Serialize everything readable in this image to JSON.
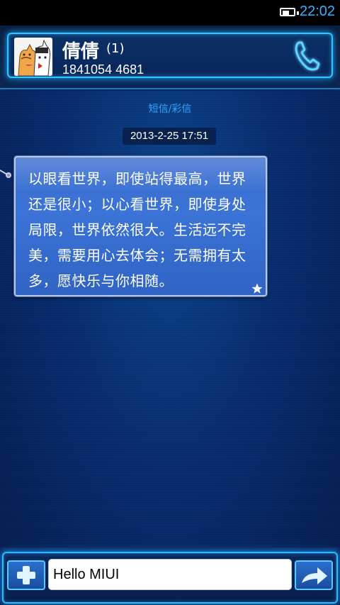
{
  "status_bar": {
    "time": "22:02",
    "battery_icon": "battery-icon"
  },
  "header": {
    "contact_name": "倩倩",
    "message_count": "(1)",
    "phone_number": "1841054 4681",
    "call_icon": "phone-icon"
  },
  "conversation": {
    "type_label": "短信/彩信",
    "timestamp": "2013-2-25 17:51",
    "message": "以眼看世界，即使站得最高，世界还是很小；以心看世界，即使身处局限，世界依然很大。生活远不完美，需要用心去体会；无需拥有太多，愿快乐与你相随。",
    "star_icon": "star-icon"
  },
  "composer": {
    "input_value": "Hello MIUI",
    "add_icon": "plus-icon",
    "send_icon": "send-arrow-icon"
  },
  "colors": {
    "accent": "#35c4ff",
    "bubble": "#3a6ecf",
    "background": "#0a2f73"
  }
}
